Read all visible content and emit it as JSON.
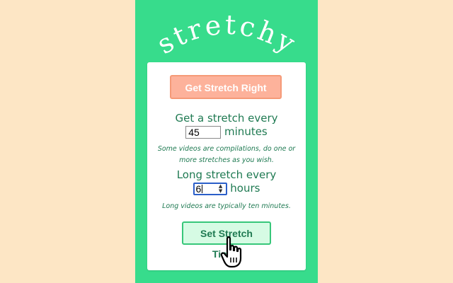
{
  "app": {
    "logo_text": "stretchy"
  },
  "actions": {
    "stretch_now_label": "Get Stretch Right Now",
    "set_times_label": "Set Stretch Times"
  },
  "interval": {
    "prefix": "Get a stretch every",
    "value": "45",
    "unit": "minutes",
    "note": "Some videos are compilations, do one or more stretches as you wish."
  },
  "long_interval": {
    "prefix": "Long stretch every",
    "value": "6",
    "unit": "hours",
    "note": "Long videos are typically ten minutes."
  },
  "colors": {
    "page_bg": "#fde6c5",
    "panel": "#37dc8c",
    "accent_text": "#1f7a52",
    "now_button": "#fdb29b",
    "set_button": "#d6fbe4"
  },
  "icons": {
    "spinner_up": "▲",
    "spinner_down": "▼"
  }
}
